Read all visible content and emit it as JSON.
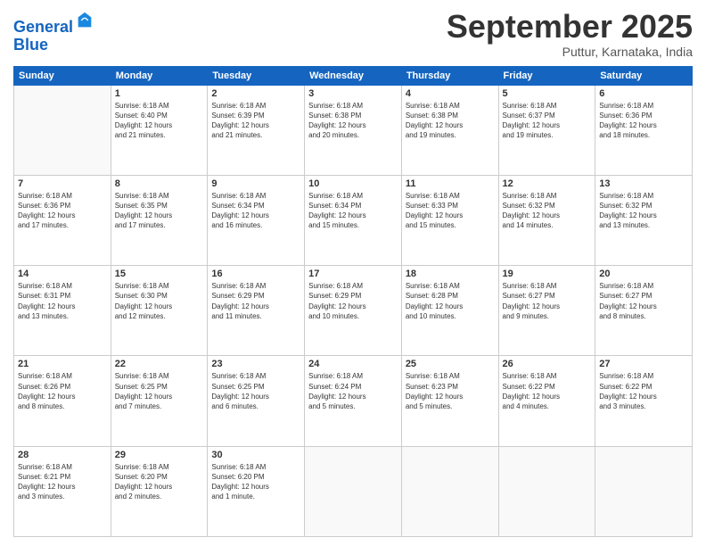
{
  "logo": {
    "line1": "General",
    "line2": "Blue"
  },
  "title": "September 2025",
  "subtitle": "Puttur, Karnataka, India",
  "weekdays": [
    "Sunday",
    "Monday",
    "Tuesday",
    "Wednesday",
    "Thursday",
    "Friday",
    "Saturday"
  ],
  "weeks": [
    [
      {
        "day": "",
        "info": ""
      },
      {
        "day": "1",
        "info": "Sunrise: 6:18 AM\nSunset: 6:40 PM\nDaylight: 12 hours\nand 21 minutes."
      },
      {
        "day": "2",
        "info": "Sunrise: 6:18 AM\nSunset: 6:39 PM\nDaylight: 12 hours\nand 21 minutes."
      },
      {
        "day": "3",
        "info": "Sunrise: 6:18 AM\nSunset: 6:38 PM\nDaylight: 12 hours\nand 20 minutes."
      },
      {
        "day": "4",
        "info": "Sunrise: 6:18 AM\nSunset: 6:38 PM\nDaylight: 12 hours\nand 19 minutes."
      },
      {
        "day": "5",
        "info": "Sunrise: 6:18 AM\nSunset: 6:37 PM\nDaylight: 12 hours\nand 19 minutes."
      },
      {
        "day": "6",
        "info": "Sunrise: 6:18 AM\nSunset: 6:36 PM\nDaylight: 12 hours\nand 18 minutes."
      }
    ],
    [
      {
        "day": "7",
        "info": "Sunrise: 6:18 AM\nSunset: 6:36 PM\nDaylight: 12 hours\nand 17 minutes."
      },
      {
        "day": "8",
        "info": "Sunrise: 6:18 AM\nSunset: 6:35 PM\nDaylight: 12 hours\nand 17 minutes."
      },
      {
        "day": "9",
        "info": "Sunrise: 6:18 AM\nSunset: 6:34 PM\nDaylight: 12 hours\nand 16 minutes."
      },
      {
        "day": "10",
        "info": "Sunrise: 6:18 AM\nSunset: 6:34 PM\nDaylight: 12 hours\nand 15 minutes."
      },
      {
        "day": "11",
        "info": "Sunrise: 6:18 AM\nSunset: 6:33 PM\nDaylight: 12 hours\nand 15 minutes."
      },
      {
        "day": "12",
        "info": "Sunrise: 6:18 AM\nSunset: 6:32 PM\nDaylight: 12 hours\nand 14 minutes."
      },
      {
        "day": "13",
        "info": "Sunrise: 6:18 AM\nSunset: 6:32 PM\nDaylight: 12 hours\nand 13 minutes."
      }
    ],
    [
      {
        "day": "14",
        "info": "Sunrise: 6:18 AM\nSunset: 6:31 PM\nDaylight: 12 hours\nand 13 minutes."
      },
      {
        "day": "15",
        "info": "Sunrise: 6:18 AM\nSunset: 6:30 PM\nDaylight: 12 hours\nand 12 minutes."
      },
      {
        "day": "16",
        "info": "Sunrise: 6:18 AM\nSunset: 6:29 PM\nDaylight: 12 hours\nand 11 minutes."
      },
      {
        "day": "17",
        "info": "Sunrise: 6:18 AM\nSunset: 6:29 PM\nDaylight: 12 hours\nand 10 minutes."
      },
      {
        "day": "18",
        "info": "Sunrise: 6:18 AM\nSunset: 6:28 PM\nDaylight: 12 hours\nand 10 minutes."
      },
      {
        "day": "19",
        "info": "Sunrise: 6:18 AM\nSunset: 6:27 PM\nDaylight: 12 hours\nand 9 minutes."
      },
      {
        "day": "20",
        "info": "Sunrise: 6:18 AM\nSunset: 6:27 PM\nDaylight: 12 hours\nand 8 minutes."
      }
    ],
    [
      {
        "day": "21",
        "info": "Sunrise: 6:18 AM\nSunset: 6:26 PM\nDaylight: 12 hours\nand 8 minutes."
      },
      {
        "day": "22",
        "info": "Sunrise: 6:18 AM\nSunset: 6:25 PM\nDaylight: 12 hours\nand 7 minutes."
      },
      {
        "day": "23",
        "info": "Sunrise: 6:18 AM\nSunset: 6:25 PM\nDaylight: 12 hours\nand 6 minutes."
      },
      {
        "day": "24",
        "info": "Sunrise: 6:18 AM\nSunset: 6:24 PM\nDaylight: 12 hours\nand 5 minutes."
      },
      {
        "day": "25",
        "info": "Sunrise: 6:18 AM\nSunset: 6:23 PM\nDaylight: 12 hours\nand 5 minutes."
      },
      {
        "day": "26",
        "info": "Sunrise: 6:18 AM\nSunset: 6:22 PM\nDaylight: 12 hours\nand 4 minutes."
      },
      {
        "day": "27",
        "info": "Sunrise: 6:18 AM\nSunset: 6:22 PM\nDaylight: 12 hours\nand 3 minutes."
      }
    ],
    [
      {
        "day": "28",
        "info": "Sunrise: 6:18 AM\nSunset: 6:21 PM\nDaylight: 12 hours\nand 3 minutes."
      },
      {
        "day": "29",
        "info": "Sunrise: 6:18 AM\nSunset: 6:20 PM\nDaylight: 12 hours\nand 2 minutes."
      },
      {
        "day": "30",
        "info": "Sunrise: 6:18 AM\nSunset: 6:20 PM\nDaylight: 12 hours\nand 1 minute."
      },
      {
        "day": "",
        "info": ""
      },
      {
        "day": "",
        "info": ""
      },
      {
        "day": "",
        "info": ""
      },
      {
        "day": "",
        "info": ""
      }
    ]
  ]
}
